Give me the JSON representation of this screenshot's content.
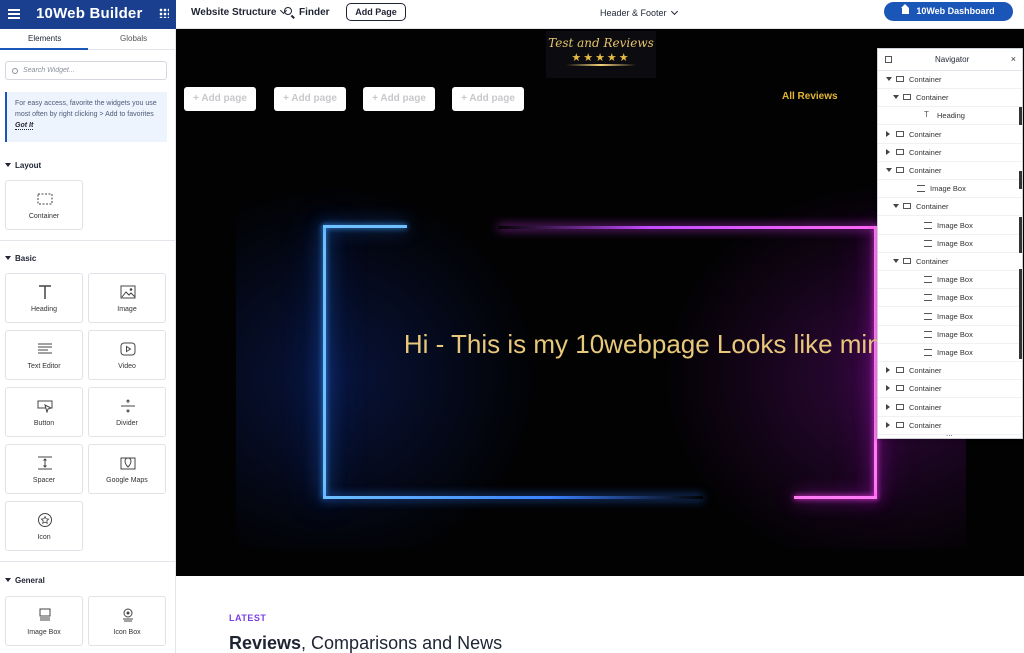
{
  "header": {
    "brand_title": "10Web Builder",
    "website_structure": "Website Structure",
    "finder": "Finder",
    "add_page": "Add Page",
    "header_footer": "Header & Footer",
    "dashboard": "10Web Dashboard",
    "accent_color": "#1a3f8f"
  },
  "sidebar": {
    "tabs": [
      "Elements",
      "Globals"
    ],
    "search_placeholder": "Search Widget...",
    "tip_text": "For easy access, favorite the widgets you use most often by right clicking > Add to favorites",
    "tip_link": "Got It",
    "sections": {
      "layout": "Layout",
      "basic": "Basic",
      "general": "General"
    },
    "widgets": {
      "container": "Container",
      "heading": "Heading",
      "image": "Image",
      "text_editor": "Text Editor",
      "video": "Video",
      "button": "Button",
      "divider": "Divider",
      "spacer": "Spacer",
      "google_maps": "Google Maps",
      "icon": "Icon",
      "image_box": "Image Box",
      "icon_box": "Icon Box"
    }
  },
  "canvas": {
    "logo_text": "Test and Reviews",
    "logo_stars": "★★★★★",
    "add_page_pills": [
      "+ Add page",
      "+ Add page",
      "+ Add page",
      "+ Add page"
    ],
    "all_reviews": "All Reviews",
    "hero_text": "Hi - This is my 10webpage Looks like mine",
    "neon_colors": {
      "blue": "#3ea1ff",
      "pink": "#ff3df0"
    }
  },
  "navigator": {
    "title": "Navigator",
    "close": "×",
    "items": [
      {
        "label": "Container",
        "depth": 0,
        "arrow": "down",
        "icon": "container"
      },
      {
        "label": "Container",
        "depth": 1,
        "arrow": "down",
        "icon": "container"
      },
      {
        "label": "Heading",
        "depth": 2,
        "arrow": "none",
        "icon": "heading"
      },
      {
        "label": "Container",
        "depth": 0,
        "arrow": "right",
        "icon": "container"
      },
      {
        "label": "Container",
        "depth": 0,
        "arrow": "right",
        "icon": "container"
      },
      {
        "label": "Container",
        "depth": 0,
        "arrow": "down",
        "icon": "container"
      },
      {
        "label": "Image Box",
        "depth": 1,
        "arrow": "none",
        "icon": "image-box"
      },
      {
        "label": "Container",
        "depth": 1,
        "arrow": "down",
        "icon": "container"
      },
      {
        "label": "Image Box",
        "depth": 2,
        "arrow": "none",
        "icon": "image-box"
      },
      {
        "label": "Image Box",
        "depth": 2,
        "arrow": "none",
        "icon": "image-box"
      },
      {
        "label": "Container",
        "depth": 1,
        "arrow": "down",
        "icon": "container"
      },
      {
        "label": "Image Box",
        "depth": 2,
        "arrow": "none",
        "icon": "image-box"
      },
      {
        "label": "Image Box",
        "depth": 2,
        "arrow": "none",
        "icon": "image-box"
      },
      {
        "label": "Image Box",
        "depth": 2,
        "arrow": "none",
        "icon": "image-box"
      },
      {
        "label": "Image Box",
        "depth": 2,
        "arrow": "none",
        "icon": "image-box"
      },
      {
        "label": "Image Box",
        "depth": 2,
        "arrow": "none",
        "icon": "image-box"
      },
      {
        "label": "Container",
        "depth": 0,
        "arrow": "right",
        "icon": "container"
      },
      {
        "label": "Container",
        "depth": 0,
        "arrow": "right",
        "icon": "container"
      },
      {
        "label": "Container",
        "depth": 0,
        "arrow": "right",
        "icon": "container"
      },
      {
        "label": "Container",
        "depth": 0,
        "arrow": "right",
        "icon": "container"
      }
    ],
    "more": "..."
  },
  "below": {
    "latest": "LATEST",
    "title_bold": "Reviews",
    "title_rest": ", Comparisons and News"
  }
}
